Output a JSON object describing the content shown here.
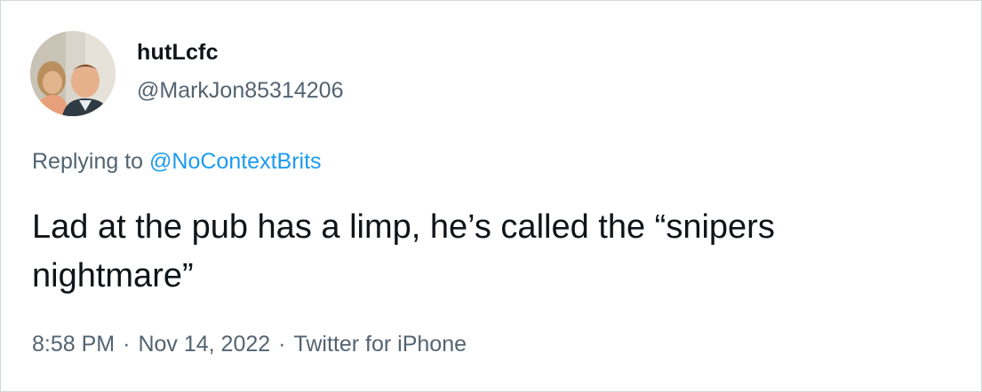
{
  "user": {
    "display_name": "hutLcfc",
    "handle": "@MarkJon85314206"
  },
  "reply": {
    "prefix": "Replying to ",
    "mention": "@NoContextBrits"
  },
  "tweet": {
    "text": "Lad at the pub has a limp, he’s called the “snipers\nnightmare”"
  },
  "meta": {
    "time": "8:58 PM",
    "separator": "·",
    "date": "Nov 14, 2022",
    "source": "Twitter for iPhone"
  },
  "colors": {
    "text": "#0f1419",
    "secondary": "#536471",
    "link": "#1d9bf0",
    "border": "#cfd9de"
  }
}
